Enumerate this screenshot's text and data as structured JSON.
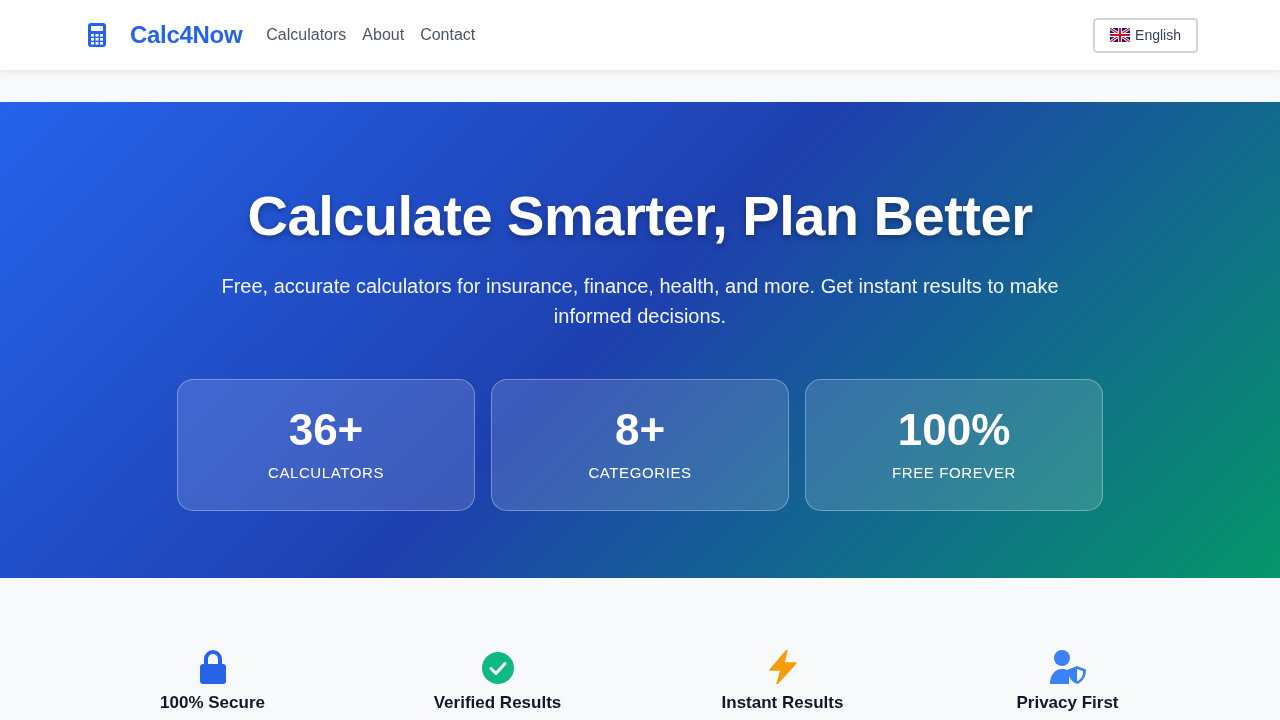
{
  "navbar": {
    "brand": "Calc4Now",
    "links": [
      {
        "label": "Calculators"
      },
      {
        "label": "About"
      },
      {
        "label": "Contact"
      }
    ],
    "language_button": {
      "label": "English"
    }
  },
  "hero": {
    "title": "Calculate Smarter, Plan Better",
    "subtitle": "Free, accurate calculators for insurance, finance, health, and more. Get instant results to make informed decisions.",
    "stats": [
      {
        "value": "36+",
        "label": "CALCULATORS"
      },
      {
        "value": "8+",
        "label": "CATEGORIES"
      },
      {
        "value": "100%",
        "label": "FREE FOREVER"
      }
    ]
  },
  "features": [
    {
      "title": "100% Secure",
      "color": "#2563eb"
    },
    {
      "title": "Verified Results",
      "color": "#10b981"
    },
    {
      "title": "Instant Results",
      "color": "#f59e0b"
    },
    {
      "title": "Privacy First",
      "color": "#3b82f6"
    }
  ]
}
